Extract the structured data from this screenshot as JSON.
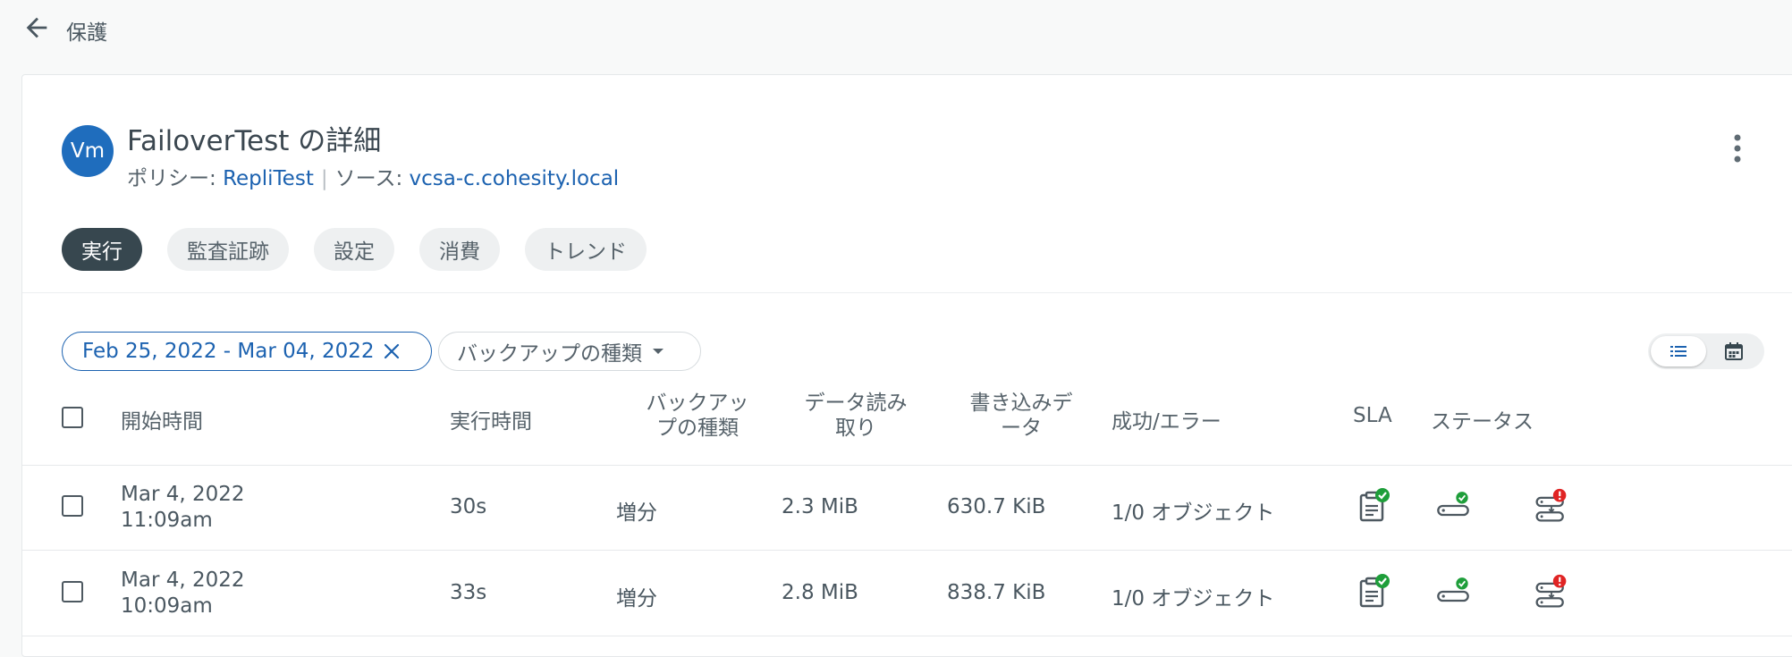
{
  "header": {
    "back_label": "保護"
  },
  "group": {
    "avatar": "Vm",
    "title": "FailoverTest の詳細",
    "policy_label": "ポリシー: ",
    "policy_value": "RepliTest",
    "source_label": "ソース: ",
    "source_value": "vcsa-c.cohesity.local"
  },
  "tabs": [
    {
      "label": "実行",
      "active": true
    },
    {
      "label": "監査証跡",
      "active": false
    },
    {
      "label": "設定",
      "active": false
    },
    {
      "label": "消費",
      "active": false
    },
    {
      "label": "トレンド",
      "active": false
    }
  ],
  "filters": {
    "date_range": "Feb 25, 2022 - Mar 04, 2022",
    "backup_type": "バックアップの種類"
  },
  "table": {
    "headers": {
      "start_time": "開始時間",
      "duration": "実行時間",
      "backup_type_1": "バックアッ",
      "backup_type_2": "プの種類",
      "data_read_1": "データ読み",
      "data_read_2": "取り",
      "data_written_1": "書き込みデ",
      "data_written_2": "ータ",
      "success_error": "成功/エラー",
      "sla": "SLA",
      "status": "ステータス"
    },
    "rows": [
      {
        "date": "Mar 4, 2022",
        "time": "11:09am",
        "duration": "30s",
        "type": "増分",
        "read": "2.3 MiB",
        "written": "630.7 KiB",
        "result": "1/0 オブジェクト"
      },
      {
        "date": "Mar 4, 2022",
        "time": "10:09am",
        "duration": "33s",
        "type": "増分",
        "read": "2.8 MiB",
        "written": "838.7 KiB",
        "result": "1/0 オブジェクト"
      }
    ]
  },
  "colors": {
    "accent": "#1c62b0",
    "active_tab": "#37474f",
    "success": "#1e9e3a",
    "error": "#e02424"
  },
  "icons": {
    "sla": "sla-met-icon",
    "backup": "backup-success-icon",
    "replication": "replication-error-icon"
  }
}
